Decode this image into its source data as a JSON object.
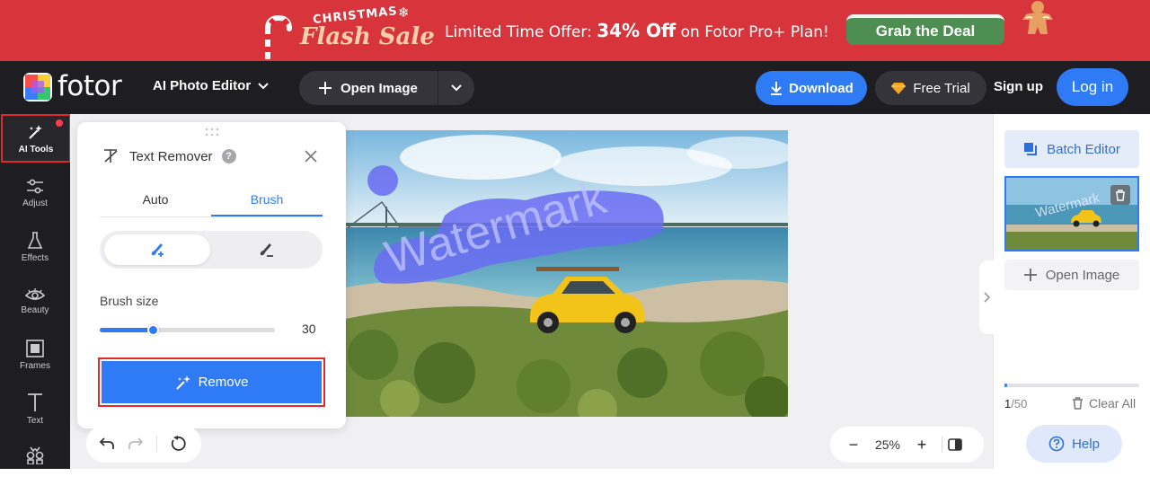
{
  "promo": {
    "christmas": "CHRISTMAS",
    "flash_sale": "Flash Sale",
    "offer_prefix": "Limited Time Offer: ",
    "offer_highlight": "34% Off",
    "offer_suffix": " on Fotor Pro+ Plan!",
    "cta": "Grab the Deal",
    "bg_color": "#d7343c"
  },
  "nav": {
    "logo": "fotor",
    "product_menu": "AI Photo Editor",
    "open_image": "Open Image",
    "download": "Download",
    "free_trial": "Free Trial",
    "sign_up": "Sign up",
    "log_in": "Log in",
    "accent": "#2f7bf6"
  },
  "tools": [
    {
      "label": "AI Tools",
      "icon": "sparkle-wand-icon",
      "active": true
    },
    {
      "label": "Adjust",
      "icon": "sliders-icon"
    },
    {
      "label": "Effects",
      "icon": "flask-icon"
    },
    {
      "label": "Beauty",
      "icon": "eye-icon"
    },
    {
      "label": "Frames",
      "icon": "frame-icon"
    },
    {
      "label": "Text",
      "icon": "text-icon"
    },
    {
      "label": "",
      "icon": "elements-icon"
    }
  ],
  "panel": {
    "title": "Text Remover",
    "tabs": [
      "Auto",
      "Brush"
    ],
    "active_tab": "Brush",
    "brush_size_label": "Brush size",
    "brush_size_value": "30",
    "brush_size_fraction": 0.3,
    "remove_button": "Remove"
  },
  "canvas": {
    "watermark_text": "Watermark",
    "zoom_level": "25%"
  },
  "right": {
    "batch_editor": "Batch Editor",
    "open_image": "Open Image",
    "count_current": "1",
    "count_total": "/50",
    "clear_all": "Clear All",
    "help": "Help",
    "thumb_watermark": "Watermark"
  }
}
